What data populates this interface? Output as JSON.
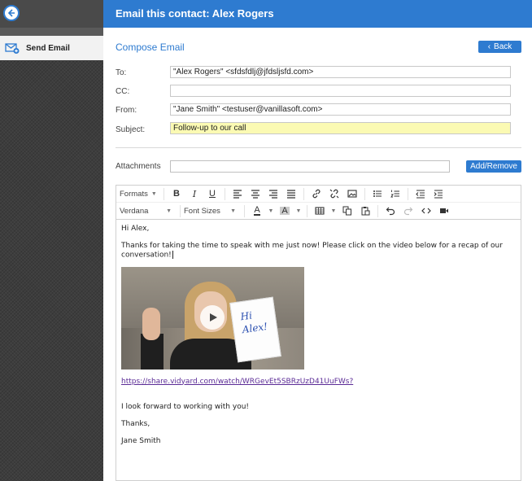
{
  "header": {
    "title": "Email this contact: Alex Rogers"
  },
  "sidebar": {
    "items": [
      {
        "label": "Send Email",
        "icon": "send-email-icon"
      }
    ]
  },
  "compose": {
    "title": "Compose Email",
    "back_label": "Back",
    "to_label": "To:",
    "to_value": "\"Alex Rogers\" <sfdsfdlj@jfdsljsfd.com>",
    "cc_label": "CC:",
    "cc_value": "",
    "from_label": "From:",
    "from_value": "\"Jane Smith\" <testuser@vanillasoft.com>",
    "subject_label": "Subject:",
    "subject_value": "Follow-up to our call",
    "attachments_label": "Attachments",
    "add_remove_label": "Add/Remove"
  },
  "toolbar": {
    "formats_label": "Formats",
    "font_label": "Verdana",
    "font_size_label": "Font Sizes"
  },
  "body": {
    "greeting": "Hi Alex,",
    "paragraph": "Thanks for taking the time to speak with me just now! Please click on the video below for a recap of our conversation!",
    "video_card_text": "Hi Alex!",
    "link": "https://share.vidyard.com/watch/WRGevEt5SBRzUzD41UuFWs?",
    "closing1": "I look forward to working with you!",
    "closing2": "Thanks,",
    "signature": "Jane Smith"
  },
  "colors": {
    "accent": "#2e7bd0",
    "subject_highlight": "#fbfab3",
    "link": "#5b2b96"
  }
}
